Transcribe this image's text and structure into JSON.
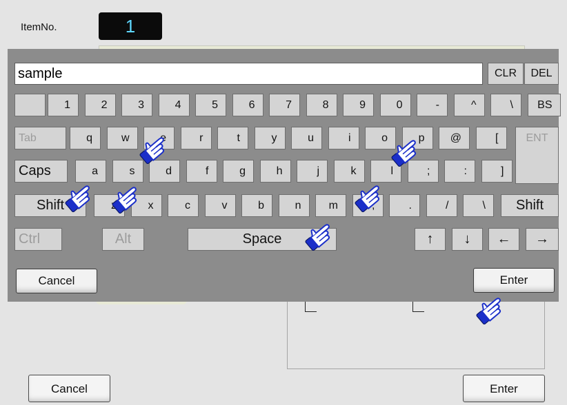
{
  "dialog": {
    "item_no_label": "ItemNo.",
    "item_no_value": "1",
    "cancel_label": "Cancel",
    "enter_label": "Enter"
  },
  "keyboard": {
    "input_value": "sample",
    "clr_label": "CLR",
    "del_label": "DEL",
    "row1": [
      "1",
      "2",
      "3",
      "4",
      "5",
      "6",
      "7",
      "8",
      "9",
      "0",
      "-",
      "^",
      "\\",
      "BS"
    ],
    "row2": [
      "Tab",
      "q",
      "w",
      "e",
      "r",
      "t",
      "y",
      "u",
      "i",
      "o",
      "p",
      "@",
      "[",
      "ENT"
    ],
    "row3": [
      "Caps",
      "a",
      "s",
      "d",
      "f",
      "g",
      "h",
      "j",
      "k",
      "l",
      ";",
      ":",
      "]"
    ],
    "row4": [
      "Shift",
      "z",
      "x",
      "c",
      "v",
      "b",
      "n",
      "m",
      ",",
      ".",
      "/",
      "\\",
      "Shift"
    ],
    "row5": [
      "Ctrl",
      "Alt",
      "Space",
      "↑",
      "↓",
      "←",
      "→"
    ],
    "cancel_label": "Cancel",
    "enter_label": "Enter"
  },
  "icons": {
    "pointer": "pointing-hand-icon"
  },
  "colors": {
    "keyboard_bg": "#8c8c8c",
    "key_bg": "#d4d4d4",
    "item_no_text": "#5fd8ff",
    "hand_blue": "#1b2fc9"
  }
}
